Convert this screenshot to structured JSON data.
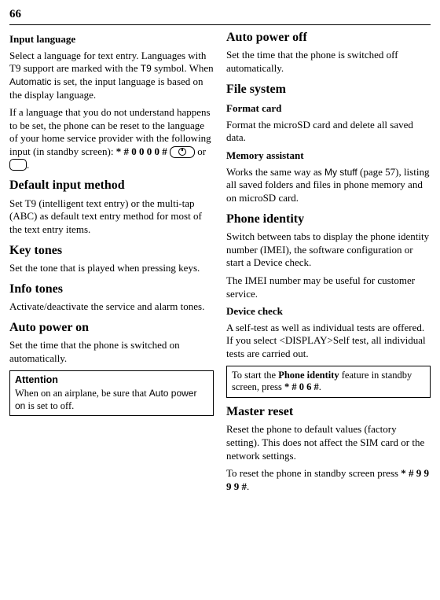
{
  "page_number": "66",
  "left": {
    "input_language": {
      "heading": "Input language",
      "p1_a": "Select a language for text entry. Languages with T9 support are marked with the ",
      "p1_t9": "T9",
      "p1_b": " symbol. When ",
      "p1_auto": "Automatic",
      "p1_c": " is set, the input language is based on the display language.",
      "p2_a": "If a language that you do not understand happens to be set, the phone can be reset to the language of your home service provider with the following input (in standby screen): ",
      "p2_code": "* # 0 0 0 0 #",
      "p2_b": " ",
      "p2_or": "or ",
      "p2_end": "."
    },
    "default_input": {
      "heading": "Default input method",
      "p": "Set T9 (intelligent text entry) or the multi-tap (ABC) as default text entry method for most of the text entry items."
    },
    "key_tones": {
      "heading": "Key tones",
      "p": "Set the tone that is played when pressing keys."
    },
    "info_tones": {
      "heading": "Info tones",
      "p": "Activate/deactivate the service and alarm tones."
    },
    "auto_on": {
      "heading": "Auto power on",
      "p": "Set the time that the phone is switched on automatically."
    },
    "attention_box": {
      "title": "Attention",
      "body_a": "When on an airplane, be sure that ",
      "body_b": "Auto power on",
      "body_c": " is set to off."
    }
  },
  "right": {
    "auto_off": {
      "heading": "Auto power off",
      "p": "Set the time that the phone is switched off automatically."
    },
    "file_system": {
      "heading": "File system",
      "format_card_h": "Format card",
      "format_card_p": "Format the microSD card and delete all saved data.",
      "mem_assist_h": "Memory assistant",
      "mem_assist_a": "Works the same way as ",
      "mem_assist_b": "My stuff",
      "mem_assist_c": " (page 57), listing all saved folders and files in phone memory and on microSD card."
    },
    "phone_identity": {
      "heading": "Phone identity",
      "p1": "Switch between tabs to display the phone identity number (IMEI), the software configuration or start a Device check.",
      "p2": "The IMEI number may be useful for customer service.",
      "device_check_h": "Device check",
      "device_check_p": "A self-test as well as individual tests are offered. If you select <DISPLAY>Self test, all individual tests are carried out."
    },
    "identity_box": {
      "a": "To start the ",
      "b": "Phone identity",
      "c": " feature in standby screen, press ",
      "code": "* # 0 6 #",
      "d": "."
    },
    "master_reset": {
      "heading": "Master reset",
      "p1": "Reset the phone to default values (factory setting). This does not affect the SIM card or the network settings.",
      "p2_a": "To reset the phone in standby screen press ",
      "p2_code": "* # 9 9 9 9 #",
      "p2_b": "."
    }
  }
}
